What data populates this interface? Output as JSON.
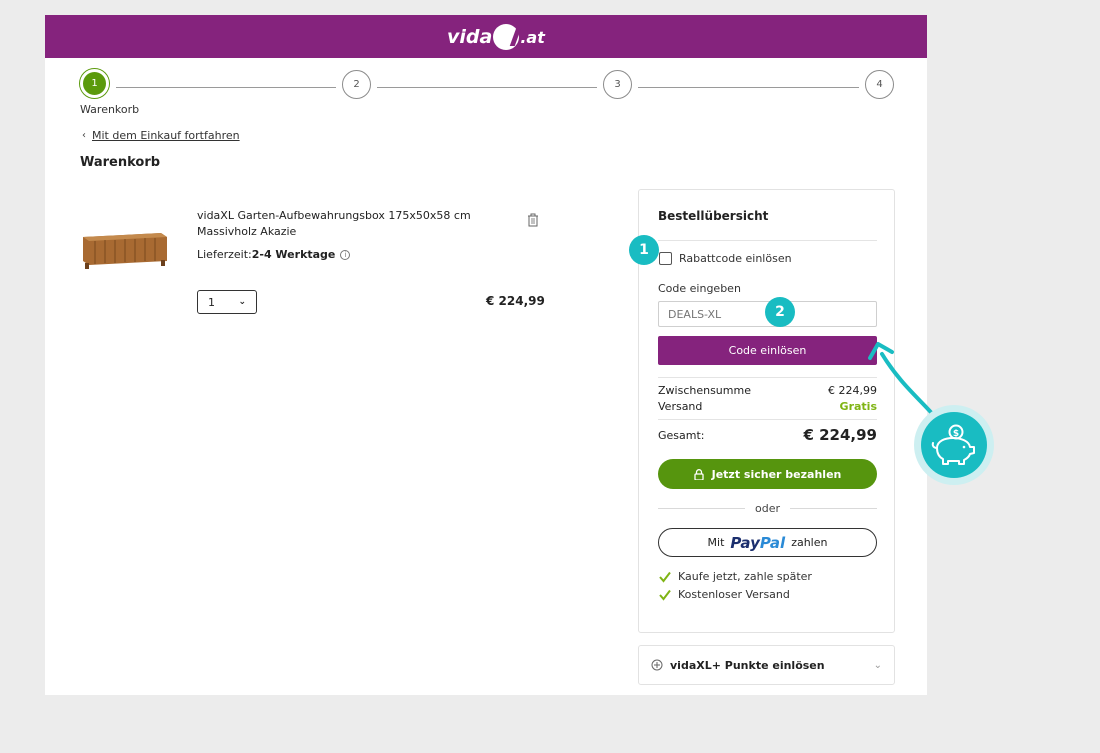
{
  "header": {
    "logo_text": "vida",
    "logo_tld": ".at",
    "brand_color": "#85237d"
  },
  "stepper": {
    "steps": [
      "1",
      "2",
      "3",
      "4"
    ],
    "active_label": "Warenkorb",
    "active_color": "#5b9a0c"
  },
  "nav": {
    "back_link": "Mit dem Einkauf fortfahren"
  },
  "page": {
    "title": "Warenkorb"
  },
  "cart": {
    "item": {
      "name": "vidaXL Garten-Aufbewahrungsbox 175x50x58 cm Massivholz Akazie",
      "delivery_label": "Lieferzeit:",
      "delivery_value": "2-4 Werktage",
      "quantity": "1",
      "price": "€ 224,99"
    }
  },
  "summary": {
    "title": "Bestellübersicht",
    "coupon_checkbox_label": "Rabattcode einlösen",
    "code_label": "Code eingeben",
    "code_placeholder": "DEALS-XL",
    "code_button": "Code einlösen",
    "subtotal_label": "Zwischensumme",
    "subtotal_value": "€ 224,99",
    "shipping_label": "Versand",
    "shipping_value": "Gratis",
    "total_label": "Gesamt:",
    "total_value": "€ 224,99",
    "pay_button": "Jetzt sicher bezahlen",
    "or_text": "oder",
    "paypal_prefix": "Mit",
    "paypal_brand_1": "Pay",
    "paypal_brand_2": "Pal",
    "paypal_suffix": "zahlen",
    "benefits": [
      "Kaufe jetzt, zahle später",
      "Kostenloser Versand"
    ]
  },
  "points": {
    "label": "vidaXL+ Punkte einlösen"
  },
  "annotations": {
    "badge_1": "1",
    "badge_2": "2",
    "accent_color": "#19bcc2"
  }
}
